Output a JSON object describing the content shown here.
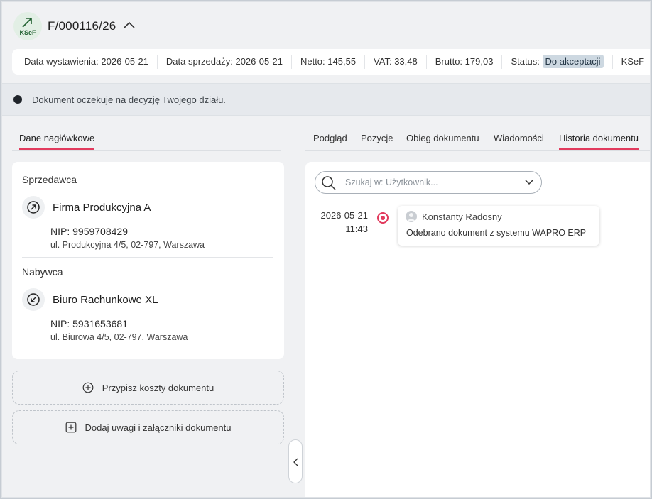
{
  "header": {
    "logo_text": "KSeF",
    "document_number": "F/000116/26"
  },
  "info": {
    "issue_date_label": "Data wystawienia:",
    "issue_date": "2026-05-21",
    "sale_date_label": "Data sprzedaży:",
    "sale_date": "2026-05-21",
    "net_label": "Netto:",
    "net": "145,55",
    "vat_label": "VAT:",
    "vat": "33,48",
    "gross_label": "Brutto:",
    "gross": "179,03",
    "status_label": "Status:",
    "status": "Do akceptacji",
    "ksef_label": "KSeF"
  },
  "notice": {
    "text": "Dokument oczekuje na decyzję Twojego działu."
  },
  "left": {
    "tab": "Dane nagłówkowe",
    "seller": {
      "label": "Sprzedawca",
      "name": "Firma Produkcyjna A",
      "nip": "NIP: 9959708429",
      "address": "ul. Produkcyjna 4/5, 02-797, Warszawa"
    },
    "buyer": {
      "label": "Nabywca",
      "name": "Biuro Rachunkowe XL",
      "nip": "NIP: 5931653681",
      "address": "ul. Biurowa 4/5, 02-797, Warszawa"
    },
    "assign_costs_label": "Przypisz koszty dokumentu",
    "add_notes_label": "Dodaj uwagi i załączniki dokumentu"
  },
  "right": {
    "tabs": [
      "Podgląd",
      "Pozycje",
      "Obieg dokumentu",
      "Wiadomości",
      "Historia dokumentu"
    ],
    "active_tab": "Historia dokumentu",
    "search_placeholder": "Szukaj w: Użytkownik...",
    "history": [
      {
        "date": "2026-05-21",
        "time": "11:43",
        "user": "Konstanty Radosny",
        "message": "Odebrano dokument z systemu WAPRO ERP"
      }
    ]
  },
  "colors": {
    "accent": "#e23a5d",
    "status_badge_bg": "#cdd8e1",
    "background": "#f0f1f3"
  }
}
